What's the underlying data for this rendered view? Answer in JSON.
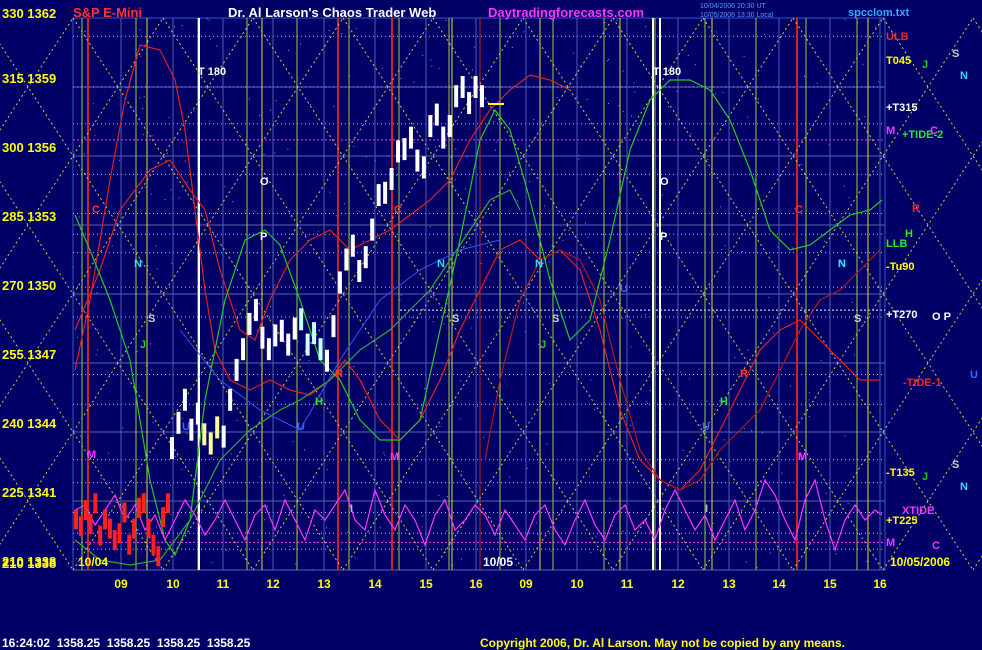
{
  "header": {
    "symbol": "S&P E-Mini",
    "title": "Dr. Al Larson's Chaos Trader Web",
    "site": "Daytradingforecasts.com",
    "stamp_line1": "10/04/2006 20:30 UT",
    "stamp_line2": "10/05/2006 13:30 Local",
    "file": "spcclom.txt"
  },
  "footer": {
    "time": "16:24:02",
    "quotes": [
      "1358.25",
      "1358.25",
      "1358.25",
      "1358.25"
    ],
    "copyright": "Copyright 2006, Dr. Al Larson. May not be copied by any means."
  },
  "chart_data": {
    "type": "candlestick",
    "y_axis": {
      "left_labels": [
        "330",
        "315",
        "300",
        "285",
        "270",
        "255",
        "240",
        "225",
        "210"
      ],
      "price_labels": [
        "1362",
        "1359",
        "1356",
        "1353",
        "1350",
        "1347",
        "1344",
        "1341",
        "1338"
      ],
      "ylim": [
        1338,
        1362
      ]
    },
    "x_axis": {
      "ticks": [
        "09",
        "10",
        "11",
        "12",
        "13",
        "14",
        "15",
        "16",
        "09",
        "10",
        "11",
        "12",
        "13",
        "14",
        "15",
        "16"
      ],
      "date_labels": [
        "10/04",
        "10/05",
        "10/05/2006"
      ]
    },
    "price_bars": {
      "red_section": [
        1340.2,
        1339.9,
        1340.6,
        1340.0,
        1340.9,
        1339.5,
        1340.2,
        1339.8,
        1339.3,
        1339.6,
        1340.5,
        1339.1,
        1339.8,
        1340.7,
        1340.9,
        1339.8,
        1339.1,
        1338.6,
        1340.3,
        1340.9
      ],
      "white_section": [
        1343.3,
        1344.4,
        1345.4,
        1344.1,
        1344.8,
        1343.9,
        1343.5,
        1344.2,
        1343.8,
        1345.4,
        1346.7,
        1347.6,
        1348.7,
        1349.3,
        1348.1,
        1347.6,
        1348.2,
        1348.4,
        1347.8,
        1348.5,
        1348.9,
        1347.8,
        1348.3,
        1347.6,
        1347.1,
        1348.6,
        1350.5,
        1351.5,
        1352.1,
        1351.0,
        1351.6,
        1352.8,
        1354.3,
        1354.4,
        1355.0,
        1356.2,
        1356.3,
        1356.8,
        1355.8,
        1355.5,
        1357.3,
        1357.8,
        1356.8,
        1357.3,
        1358.6,
        1359.0,
        1358.3,
        1359.0,
        1358.6
      ]
    },
    "right_labels": [
      "ULB",
      "T045",
      "J",
      "S",
      "N",
      "+T315",
      "M",
      "+TIDE-2",
      "C",
      "R",
      "H",
      "LLB",
      "-Tu90",
      "+T270",
      "O P",
      "U",
      "-TIDE-1",
      "-T135",
      "J",
      "S",
      "N",
      "XTIDE",
      "+T225",
      "M",
      "C"
    ],
    "chart_labels": [
      "T 180",
      "T 180",
      "O",
      "O",
      "P",
      "P",
      "C",
      "C",
      "C",
      "N",
      "N",
      "N",
      "N",
      "N",
      "S",
      "S",
      "S",
      "S",
      "R",
      "R",
      "R",
      "U",
      "U",
      "U",
      "U",
      "H",
      "H",
      "M",
      "M",
      "M",
      "M",
      "J",
      "J",
      "I",
      "I"
    ],
    "colors": {
      "background": "#000066",
      "grid_v": "#9acd32",
      "grid_h": "#cccc44",
      "red_line": "#e02020",
      "green_line": "#22cc22",
      "magenta_line": "#ff33ff",
      "axis_text": "#ffff00",
      "title_red": "#ff3333",
      "title_white": "#ffffff",
      "site_magenta": "#ff33ff",
      "stamp_blue": "#5599ff",
      "file_cyan": "#33aaff"
    }
  }
}
